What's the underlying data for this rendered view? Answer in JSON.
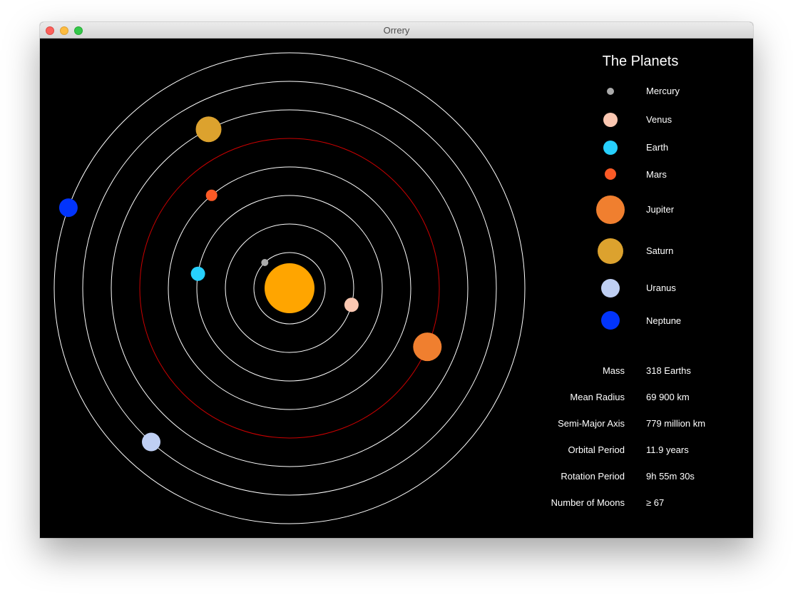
{
  "window": {
    "title": "Orrery"
  },
  "sun": {
    "name": "Sun",
    "color": "#ffa500"
  },
  "orbit_color": "#ffffff",
  "selected_orbit_color": "#cc0000",
  "selected_planet": "Jupiter",
  "planets": [
    {
      "name": "Mercury",
      "color": "#aaaaaa",
      "orbit_index": 1,
      "angle_deg": 134
    },
    {
      "name": "Venus",
      "color": "#fbc7b1",
      "orbit_index": 2,
      "angle_deg": -15
    },
    {
      "name": "Earth",
      "color": "#27d0fd",
      "orbit_index": 3,
      "angle_deg": 171
    },
    {
      "name": "Mars",
      "color": "#fb5a26",
      "orbit_index": 4,
      "angle_deg": 130
    },
    {
      "name": "Jupiter",
      "color": "#f07f2f",
      "orbit_index": 5,
      "angle_deg": -23
    },
    {
      "name": "Saturn",
      "color": "#dca22e",
      "orbit_index": 6,
      "angle_deg": 117
    },
    {
      "name": "Uranus",
      "color": "#bfcff3",
      "orbit_index": 7,
      "angle_deg": 228
    },
    {
      "name": "Neptune",
      "color": "#0234fb",
      "orbit_index": 8,
      "angle_deg": 160
    }
  ],
  "panel": {
    "title": "The Planets",
    "legend": [
      {
        "label": "Mercury",
        "color": "#aaaaaa"
      },
      {
        "label": "Venus",
        "color": "#fbc7b1"
      },
      {
        "label": "Earth",
        "color": "#27d0fd"
      },
      {
        "label": "Mars",
        "color": "#fb5a26"
      },
      {
        "label": "Jupiter",
        "color": "#f07f2f"
      },
      {
        "label": "Saturn",
        "color": "#dca22e"
      },
      {
        "label": "Uranus",
        "color": "#bfcff3"
      },
      {
        "label": "Neptune",
        "color": "#0234fb"
      }
    ],
    "info": [
      {
        "label": "Mass",
        "value": "318 Earths"
      },
      {
        "label": "Mean Radius",
        "value": "69 900 km"
      },
      {
        "label": "Semi-Major Axis",
        "value": "779 million km"
      },
      {
        "label": "Orbital Period",
        "value": "11.9 years"
      },
      {
        "label": "Rotation Period",
        "value": "9h 55m 30s"
      },
      {
        "label": "Number of Moons",
        "value": "≥ 67"
      }
    ]
  }
}
